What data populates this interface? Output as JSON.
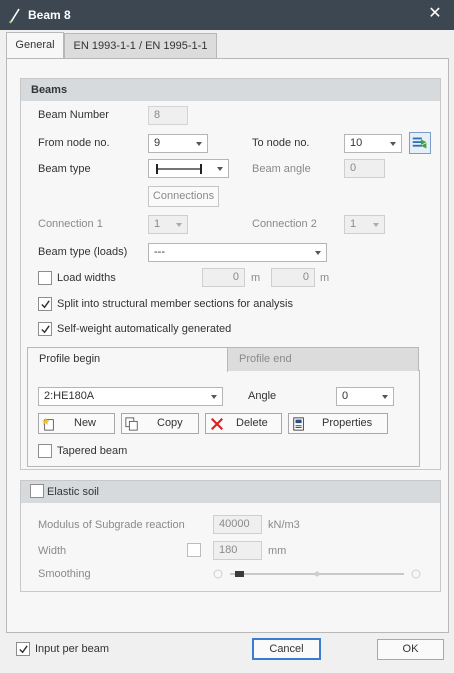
{
  "window": {
    "title": "Beam 8",
    "close_symbol": "✕"
  },
  "tabs": [
    {
      "label": "General",
      "active": true
    },
    {
      "label": "EN 1993-1-1 / EN 1995-1-1",
      "active": false
    }
  ],
  "beams": {
    "header": "Beams",
    "beam_number_label": "Beam Number",
    "beam_number_value": "8",
    "from_node_label": "From node no.",
    "from_node_value": "9",
    "to_node_label": "To node no.",
    "to_node_value": "10",
    "beam_type_label": "Beam type",
    "beam_angle_label": "Beam angle",
    "beam_angle_value": "0",
    "connections_button": "Connections",
    "connection1_label": "Connection 1",
    "connection1_value": "1",
    "connection2_label": "Connection 2",
    "connection2_value": "1",
    "beam_type_loads_label": "Beam type (loads)",
    "beam_type_loads_value": "---",
    "load_widths_label": "Load widths",
    "load_width1_value": "0",
    "load_width1_unit": "m",
    "load_width2_value": "0",
    "load_width2_unit": "m",
    "split_label": "Split into structural member sections for analysis",
    "split_checked": true,
    "self_weight_label": "Self-weight automatically generated",
    "self_weight_checked": true,
    "load_widths_checked": false
  },
  "profile": {
    "tabs": [
      {
        "label": "Profile begin",
        "active": true
      },
      {
        "label": "Profile end",
        "active": false
      }
    ],
    "section_value": "2:HE180A",
    "angle_label": "Angle",
    "angle_value": "0",
    "new_button": "New",
    "copy_button": "Copy",
    "delete_button": "Delete",
    "properties_button": "Properties",
    "tapered_label": "Tapered beam",
    "tapered_checked": false
  },
  "elastic_soil": {
    "header": "Elastic soil",
    "checked": false,
    "modulus_label": "Modulus of Subgrade reaction",
    "modulus_value": "40000",
    "modulus_unit": "kN/m3",
    "width_label": "Width",
    "width_value": "180",
    "width_unit": "mm",
    "smoothing_label": "Smoothing",
    "smoothing_level": 0.05
  },
  "footer": {
    "input_per_beam_label": "Input per beam",
    "input_per_beam_checked": true,
    "cancel_label": "Cancel",
    "ok_label": "OK"
  },
  "colors": {
    "titlebar": "#3c4752",
    "group_header": "#d7dadd",
    "focus_border": "#3b7bd0",
    "delete_red": "#d81e1e"
  },
  "icons": [
    "pencil-icon",
    "close-icon",
    "swap-nodes-icon",
    "beam-type-icon",
    "new-icon",
    "copy-icon",
    "delete-icon",
    "properties-icon"
  ]
}
